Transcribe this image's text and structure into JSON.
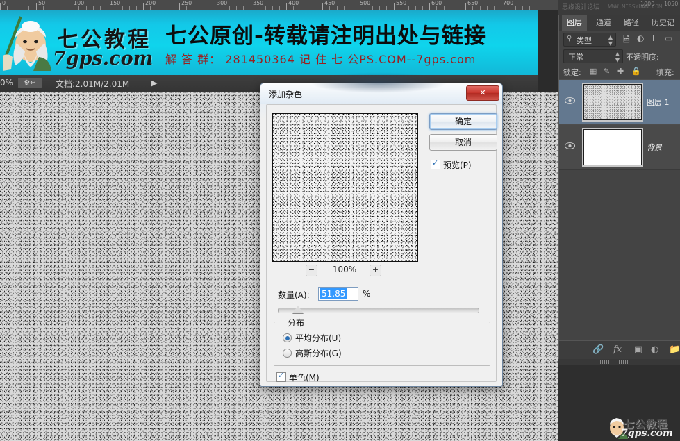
{
  "ruler": {
    "labels": [
      "0",
      "50",
      "100",
      "150",
      "200",
      "250",
      "300",
      "350",
      "400",
      "450",
      "500",
      "550",
      "600",
      "650",
      "700"
    ],
    "panel_labels": [
      "1000",
      "1050"
    ]
  },
  "banner": {
    "logo_cn": "七公教程",
    "logo_url": "7gps.com",
    "headline": "七公原创-转载请注明出处与链接",
    "subline": "解 答 群：  281450364    记 住 七 公PS.COM--7gps.com"
  },
  "status_bar": {
    "zoom": "0%",
    "doc_size": "文档:2.01M/2.01M",
    "arrow": "▶",
    "button_icon": "toggle-icon"
  },
  "watermark_top": {
    "forum": "思缘设计论坛",
    "url": "WWW.MISSYUAN.COM"
  },
  "watermark_bottom": {
    "name": "七公教程",
    "site": "7gps.com"
  },
  "panel": {
    "tabs": [
      {
        "label": "图层",
        "active": true
      },
      {
        "label": "通道",
        "active": false
      },
      {
        "label": "路径",
        "active": false
      },
      {
        "label": "历史记录",
        "active": false
      }
    ],
    "filter": {
      "search_icon": "search-icon",
      "kind": "类型",
      "kind_arrow": "▲▼",
      "icons": [
        "image-filter-icon",
        "adjustment-filter-icon",
        "text-filter-icon",
        "shape-filter-icon"
      ]
    },
    "blend_mode": "正常",
    "blend_arrow": "▲▼",
    "opacity_label": "不透明度:",
    "lock_label": "锁定:",
    "lock_icons": [
      "transparency-lock-icon",
      "image-lock-icon",
      "position-lock-icon",
      "all-lock-icon"
    ],
    "fill_label": "填充:",
    "layers": [
      {
        "name": "图层 1",
        "selected": true,
        "thumb": "noise",
        "visible": true,
        "italic": false
      },
      {
        "name": "背景",
        "selected": false,
        "thumb": "white",
        "visible": true,
        "italic": true
      }
    ],
    "bottom_icons": [
      "link-icon",
      "fx-icon",
      "mask-icon",
      "adjustment-icon",
      "group-icon"
    ],
    "fx_label": "fx"
  },
  "dialog": {
    "title": "添加杂色",
    "close_label": "✕",
    "ok_label": "确定",
    "cancel_label": "取消",
    "preview_label": "预览(P)",
    "preview_checked": true,
    "zoom": {
      "minus": "−",
      "value": "100%",
      "plus": "+"
    },
    "amount": {
      "label": "数量(A):",
      "value": "51.85",
      "unit": "%",
      "slider_position_pct": 10
    },
    "distribution": {
      "legend": "分布",
      "options": [
        {
          "label": "平均分布(U)",
          "selected": true
        },
        {
          "label": "高斯分布(G)",
          "selected": false
        }
      ]
    },
    "monochrome": {
      "label": "单色(M)",
      "checked": true
    }
  },
  "colors": {
    "accent_blue": "#3399ff",
    "banner_cyan": "#0fd4ec",
    "selected_layer": "#63788f",
    "panel_bg": "#444444",
    "close_red": "#c9372e"
  }
}
